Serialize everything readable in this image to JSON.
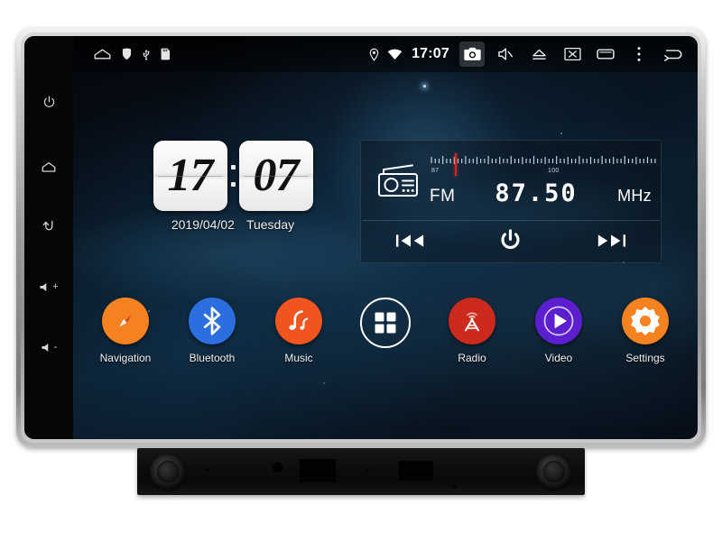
{
  "device": {
    "name": "car-head-unit",
    "bezel_color": "#9a9a9a",
    "screen_bg": "#050a12"
  },
  "hardkeys": [
    {
      "id": "power",
      "icon": "power-icon",
      "label": ""
    },
    {
      "id": "home",
      "icon": "home-icon",
      "label": ""
    },
    {
      "id": "back",
      "icon": "back-arrow-icon",
      "label": ""
    },
    {
      "id": "volume-up",
      "icon": "volume-up-icon",
      "label": "+"
    },
    {
      "id": "volume-down",
      "icon": "volume-down-icon",
      "label": "-"
    }
  ],
  "statusbar": {
    "left_icons": [
      {
        "id": "home",
        "icon": "home-outline-icon"
      },
      {
        "id": "shield",
        "icon": "shield-icon"
      },
      {
        "id": "usb",
        "icon": "usb-icon"
      },
      {
        "id": "sdcard",
        "icon": "sd-card-icon"
      }
    ],
    "location_icon": "location-pin-icon",
    "wifi_icon": "wifi-icon",
    "clock": "17:07",
    "right_buttons": [
      {
        "id": "camera",
        "icon": "camera-icon",
        "active": true
      },
      {
        "id": "mute",
        "icon": "speaker-mute-icon",
        "active": false
      },
      {
        "id": "eject",
        "icon": "eject-icon",
        "active": false
      },
      {
        "id": "screen-off",
        "icon": "screen-off-icon",
        "active": false
      },
      {
        "id": "recents",
        "icon": "recents-icon",
        "active": false
      },
      {
        "id": "overflow",
        "icon": "overflow-menu-icon",
        "active": false
      },
      {
        "id": "back",
        "icon": "back-arrow-icon",
        "active": false
      }
    ]
  },
  "clock_widget": {
    "hours": "17",
    "minutes": "07",
    "date": "2019/04/02",
    "weekday": "Tuesday"
  },
  "radio_widget": {
    "icon": "radio-icon",
    "band": "FM",
    "frequency": "87.50",
    "unit": "MHz",
    "dial_low": "87",
    "dial_high": "100",
    "needle_percent": 11,
    "needle_color": "#e02020",
    "controls": [
      {
        "id": "prev",
        "icon": "previous-track-icon",
        "label": "⏮"
      },
      {
        "id": "power",
        "icon": "power-icon",
        "label": "⏻"
      },
      {
        "id": "next",
        "icon": "next-track-icon",
        "label": "⏭"
      }
    ]
  },
  "dock": {
    "items": [
      {
        "id": "navigation",
        "label": "Navigation",
        "icon": "compass-icon",
        "color": "#f58220",
        "style": "filled"
      },
      {
        "id": "bluetooth",
        "label": "Bluetooth",
        "icon": "bluetooth-icon",
        "color": "#2a6ee0",
        "style": "filled"
      },
      {
        "id": "music",
        "label": "Music",
        "icon": "music-note-icon",
        "color": "#f1551f",
        "style": "filled"
      },
      {
        "id": "apps",
        "label": "",
        "icon": "apps-grid-icon",
        "color": "#ffffff",
        "style": "ring"
      },
      {
        "id": "radio",
        "label": "Radio",
        "icon": "radio-tower-icon",
        "color": "#cc2a1c",
        "style": "filled"
      },
      {
        "id": "video",
        "label": "Video",
        "icon": "play-circle-icon",
        "color": "#5b1fcf",
        "style": "filled"
      },
      {
        "id": "settings",
        "label": "Settings",
        "icon": "gear-icon",
        "color": "#f58220",
        "style": "filled"
      }
    ]
  }
}
